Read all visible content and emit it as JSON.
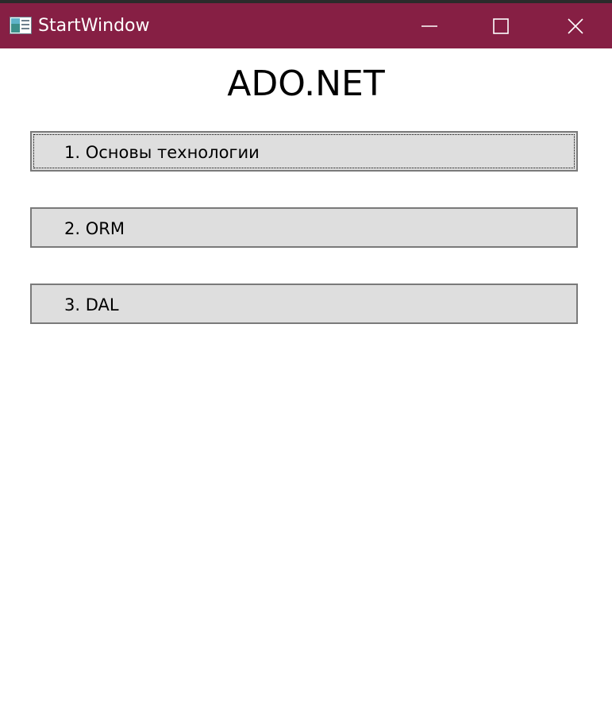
{
  "window": {
    "title": "StartWindow",
    "accent_color": "#861f44",
    "controls": {
      "minimize_icon": "minimize-icon",
      "maximize_icon": "maximize-icon",
      "close_icon": "close-icon"
    }
  },
  "main": {
    "heading": "ADO.NET",
    "buttons": [
      {
        "label": "1. Основы технологии",
        "focused": true
      },
      {
        "label": "2. ORM",
        "focused": false
      },
      {
        "label": "3. DAL",
        "focused": false
      }
    ]
  }
}
